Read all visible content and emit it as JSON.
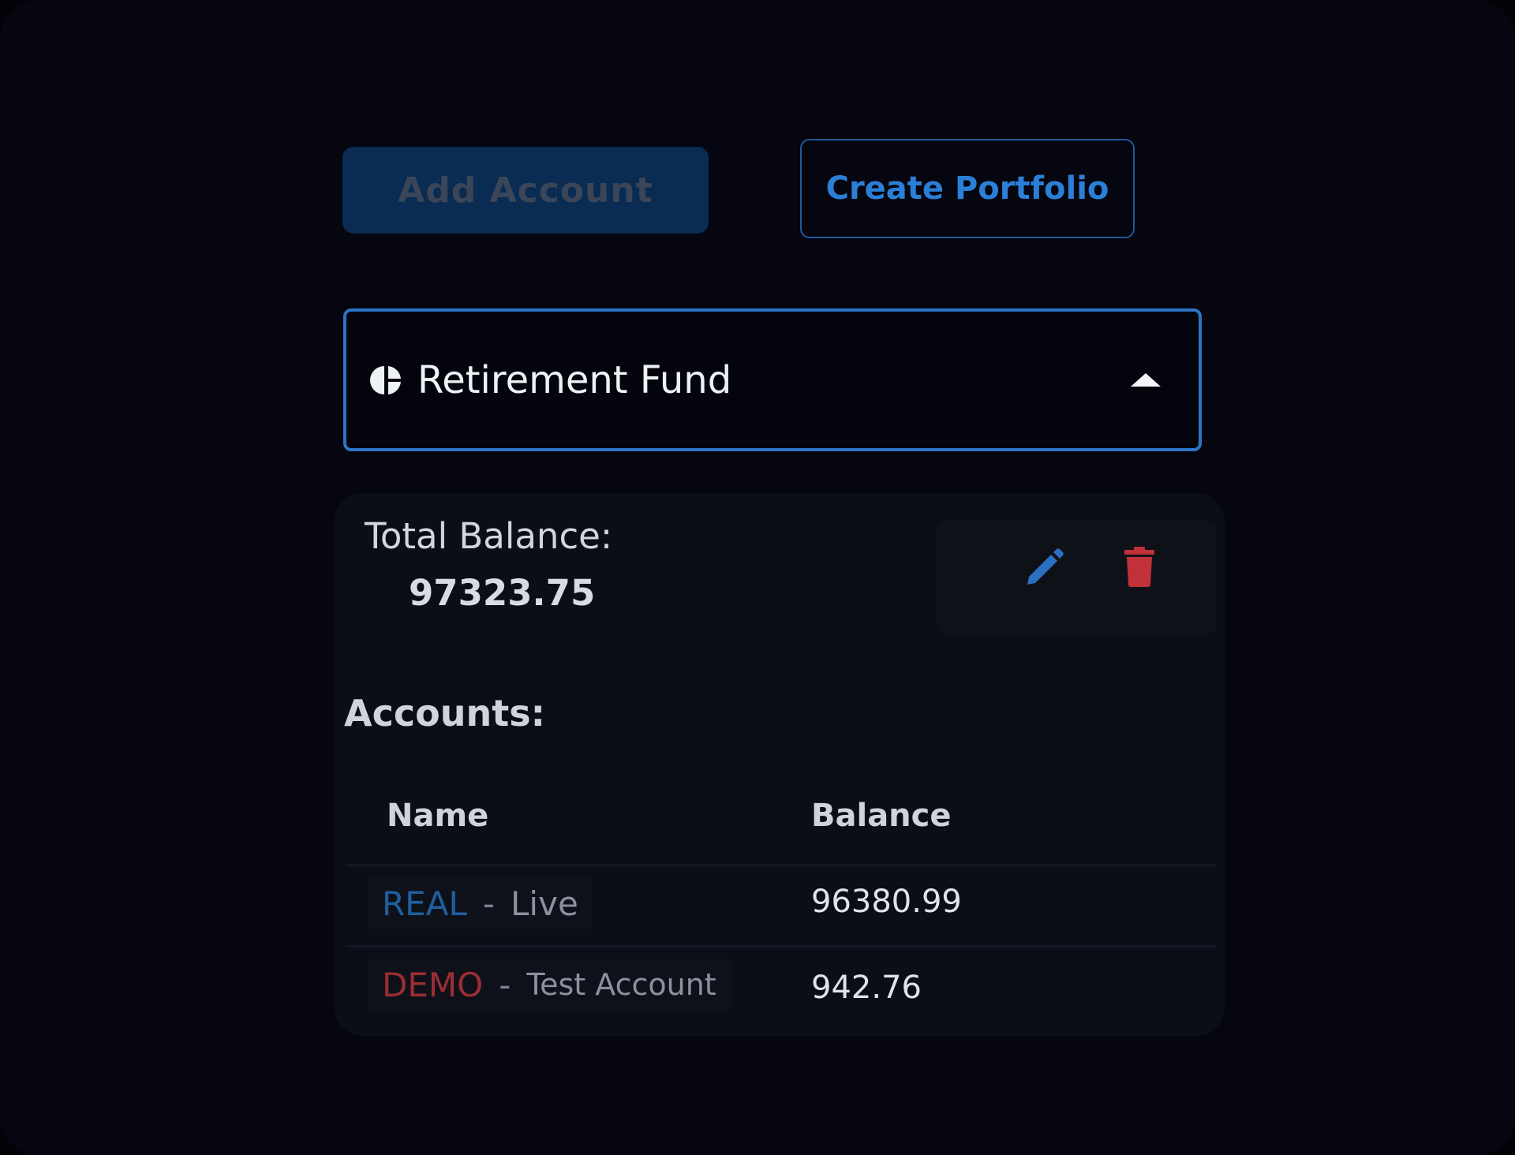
{
  "toolbar": {
    "add_account_label": "Add Account",
    "create_portfolio_label": "Create Portfolio"
  },
  "portfolio": {
    "selected_name": "Retirement Fund",
    "icon": "pie-chart-icon",
    "dropdown_state_icon": "caret-up-icon"
  },
  "summary": {
    "total_balance_label": "Total Balance:",
    "total_balance_value": "97323.75",
    "edit_icon": "pencil-icon",
    "delete_icon": "trash-icon"
  },
  "accounts": {
    "heading": "Accounts:",
    "columns": {
      "name": "Name",
      "balance": "Balance"
    },
    "rows": [
      {
        "code": "REAL",
        "separator": "-",
        "description": "Live",
        "balance": "96380.99"
      },
      {
        "code": "DEMO",
        "separator": "-",
        "description": "Test Account",
        "balance": "942.76"
      }
    ]
  },
  "colors": {
    "background": "#05060f",
    "accent": "#2d74c4",
    "add_button_bg": "#0a2b52",
    "real_code": "#1f5f9e",
    "demo_code": "#9b2d34",
    "edit_icon": "#2b6fbf",
    "delete_icon": "#c0313a"
  }
}
